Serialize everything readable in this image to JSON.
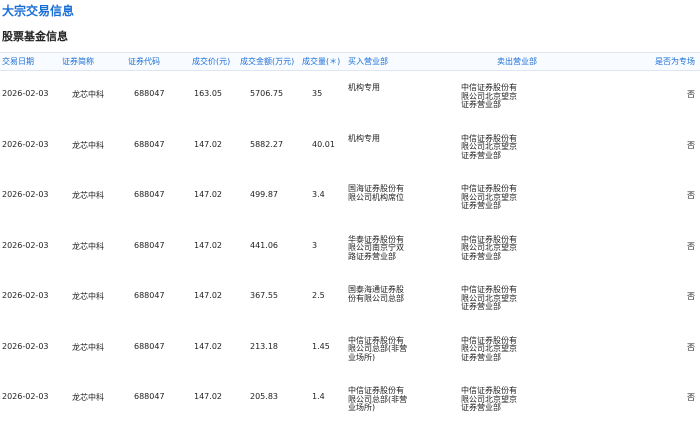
{
  "page": {
    "title": "大宗交易信息",
    "section": "股票基金信息"
  },
  "table": {
    "headers": [
      "交易日期",
      "证券简称",
      "证券代码",
      "成交价(元)",
      "成交金额(万元)",
      "成交量(＊)",
      "买入营业部",
      "卖出营业部",
      "是否为专场"
    ],
    "rows": [
      {
        "date": "2026-02-03",
        "name": "龙芯中科",
        "code": "688047",
        "price": "163.05",
        "amount": "5706.75",
        "volume": "35",
        "buyer": "机构专用",
        "seller": "中信证券股份有限公司北京望京证券营业部",
        "special": "否"
      },
      {
        "date": "2026-02-03",
        "name": "龙芯中科",
        "code": "688047",
        "price": "147.02",
        "amount": "5882.27",
        "volume": "40.01",
        "buyer": "机构专用",
        "seller": "中信证券股份有限公司北京望京证券营业部",
        "special": "否"
      },
      {
        "date": "2026-02-03",
        "name": "龙芯中科",
        "code": "688047",
        "price": "147.02",
        "amount": "499.87",
        "volume": "3.4",
        "buyer": "国海证券股份有限公司机构席位",
        "seller": "中信证券股份有限公司北京望京证券营业部",
        "special": "否"
      },
      {
        "date": "2026-02-03",
        "name": "龙芯中科",
        "code": "688047",
        "price": "147.02",
        "amount": "441.06",
        "volume": "3",
        "buyer": "华泰证券股份有限公司南京宁双路证券营业部",
        "seller": "中信证券股份有限公司北京望京证券营业部",
        "special": "否"
      },
      {
        "date": "2026-02-03",
        "name": "龙芯中科",
        "code": "688047",
        "price": "147.02",
        "amount": "367.55",
        "volume": "2.5",
        "buyer": "国泰海通证券股份有限公司总部",
        "seller": "中信证券股份有限公司北京望京证券营业部",
        "special": "否"
      },
      {
        "date": "2026-02-03",
        "name": "龙芯中科",
        "code": "688047",
        "price": "147.02",
        "amount": "213.18",
        "volume": "1.45",
        "buyer": "中信证券股份有限公司总部(非营业场所)",
        "seller": "中信证券股份有限公司北京望京证券营业部",
        "special": "否"
      },
      {
        "date": "2026-02-03",
        "name": "龙芯中科",
        "code": "688047",
        "price": "147.02",
        "amount": "205.83",
        "volume": "1.4",
        "buyer": "中信证券股份有限公司总部(非营业场所)",
        "seller": "中信证券股份有限公司北京望京证券营业部",
        "special": "否"
      }
    ]
  },
  "colors": {
    "accent": "#1a6fd6"
  }
}
